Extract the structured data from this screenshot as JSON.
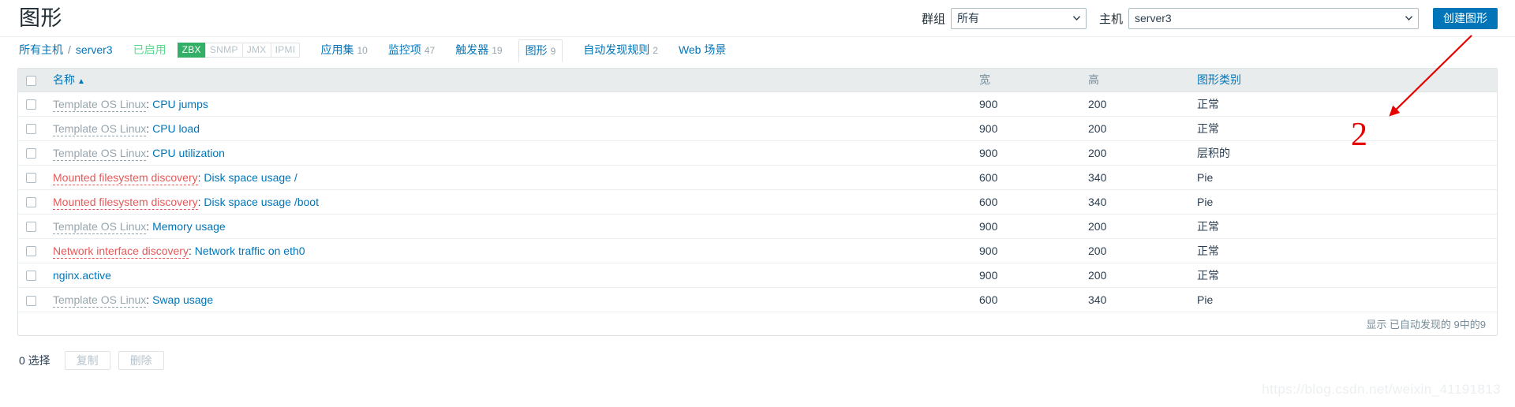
{
  "header": {
    "title": "图形",
    "filters": [
      {
        "label": "群组",
        "value": "所有",
        "name": "group"
      },
      {
        "label": "主机",
        "value": "server3",
        "name": "host"
      }
    ],
    "create_button": "创建图形"
  },
  "breadcrumb": {
    "all_hosts": "所有主机",
    "separator": "/",
    "host": "server3",
    "status": "已启用",
    "protocols": [
      {
        "label": "ZBX",
        "active": true
      },
      {
        "label": "SNMP",
        "active": false
      },
      {
        "label": "JMX",
        "active": false
      },
      {
        "label": "IPMI",
        "active": false
      }
    ],
    "tabs": [
      {
        "label": "应用集",
        "count": "10",
        "selected": false
      },
      {
        "label": "监控项",
        "count": "47",
        "selected": false
      },
      {
        "label": "触发器",
        "count": "19",
        "selected": false
      },
      {
        "label": "图形",
        "count": "9",
        "selected": true
      },
      {
        "label": "自动发现规则",
        "count": "2",
        "selected": false
      },
      {
        "label": "Web 场景",
        "count": "",
        "selected": false
      }
    ]
  },
  "table": {
    "columns": {
      "name": "名称",
      "sort_arrow": "▲",
      "width": "宽",
      "height": "高",
      "type": "图形类别"
    },
    "rows": [
      {
        "prefix": "Template OS Linux",
        "prefix_kind": "tpl",
        "name": "CPU jumps",
        "width": "900",
        "height": "200",
        "type": "正常"
      },
      {
        "prefix": "Template OS Linux",
        "prefix_kind": "tpl",
        "name": "CPU load",
        "width": "900",
        "height": "200",
        "type": "正常"
      },
      {
        "prefix": "Template OS Linux",
        "prefix_kind": "tpl",
        "name": "CPU utilization",
        "width": "900",
        "height": "200",
        "type": "层积的"
      },
      {
        "prefix": "Mounted filesystem discovery",
        "prefix_kind": "disc",
        "name": "Disk space usage /",
        "width": "600",
        "height": "340",
        "type": "Pie"
      },
      {
        "prefix": "Mounted filesystem discovery",
        "prefix_kind": "disc",
        "name": "Disk space usage /boot",
        "width": "600",
        "height": "340",
        "type": "Pie"
      },
      {
        "prefix": "Template OS Linux",
        "prefix_kind": "tpl",
        "name": "Memory usage",
        "width": "900",
        "height": "200",
        "type": "正常"
      },
      {
        "prefix": "Network interface discovery",
        "prefix_kind": "disc",
        "name": "Network traffic on eth0",
        "width": "900",
        "height": "200",
        "type": "正常"
      },
      {
        "prefix": "",
        "prefix_kind": "none",
        "name": "nginx.active",
        "width": "900",
        "height": "200",
        "type": "正常"
      },
      {
        "prefix": "Template OS Linux",
        "prefix_kind": "tpl",
        "name": "Swap usage",
        "width": "600",
        "height": "340",
        "type": "Pie"
      }
    ],
    "footer": "显示 已自动发现的 9中的9"
  },
  "action_bar": {
    "selected_text": "0 选择",
    "copy_button": "复制",
    "delete_button": "删除"
  },
  "annotation": {
    "number": "2"
  },
  "watermark": "https://blog.csdn.net/weixin_41191813",
  "colors": {
    "accent_blue": "#0275b8",
    "discovery_orange": "#e45959",
    "template_gray": "#97a6ae",
    "enabled_green": "#59db8f",
    "zbx_green": "#34af67",
    "annotation_red": "#e60000"
  }
}
